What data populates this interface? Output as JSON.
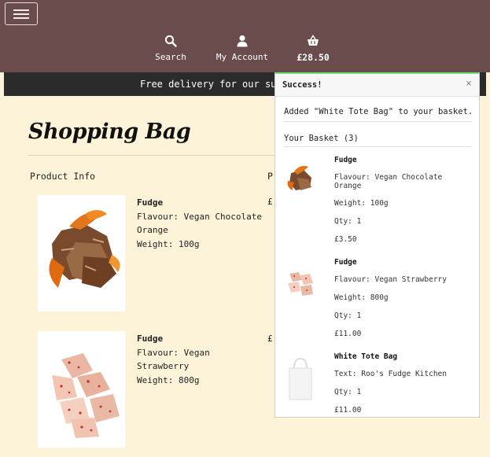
{
  "nav": {
    "search_label": "Search",
    "account_label": "My Account",
    "basket_total": "£28.50"
  },
  "banner": {
    "text": "Free delivery for our sub"
  },
  "page": {
    "title": "Shopping Bag",
    "col_product_info": "Product Info",
    "col_price_peek": "P"
  },
  "products": [
    {
      "name": "Fudge",
      "detail_1": "Flavour: Vegan Chocolate",
      "detail_2": "Orange",
      "detail_3": "Weight: 100g",
      "price_peek": "£"
    },
    {
      "name": "Fudge",
      "detail_1": "Flavour: Vegan",
      "detail_2": "Strawberry",
      "detail_3": "Weight: 800g",
      "price_peek": "£"
    }
  ],
  "toast": {
    "title": "Success!",
    "close": "×",
    "message": "Added \"White Tote Bag\" to your basket.",
    "basket_heading": "Your Basket (3)",
    "items": [
      {
        "name": "Fudge",
        "attr_1": "Flavour: Vegan Chocolate",
        "attr_2": "Orange",
        "weight": "Weight: 100g",
        "qty": "Qty: 1",
        "price": "£3.50"
      },
      {
        "name": "Fudge",
        "attr_1": "Flavour: Vegan Strawberry",
        "weight": "Weight: 800g",
        "qty": "Qty: 1",
        "price": "£11.00"
      },
      {
        "name": "White Tote Bag",
        "attr_1": "Text: Roo's Fudge Kitchen",
        "qty": "Qty: 1",
        "price": "£11.00"
      }
    ]
  },
  "colors": {
    "header_bg": "#6b4c4c",
    "page_bg": "#fdf3d8",
    "banner_bg": "#2c2b2b",
    "toast_accent": "#6ee07a"
  },
  "icons": [
    "menu-icon",
    "search-icon",
    "user-icon",
    "basket-icon",
    "close-icon"
  ]
}
